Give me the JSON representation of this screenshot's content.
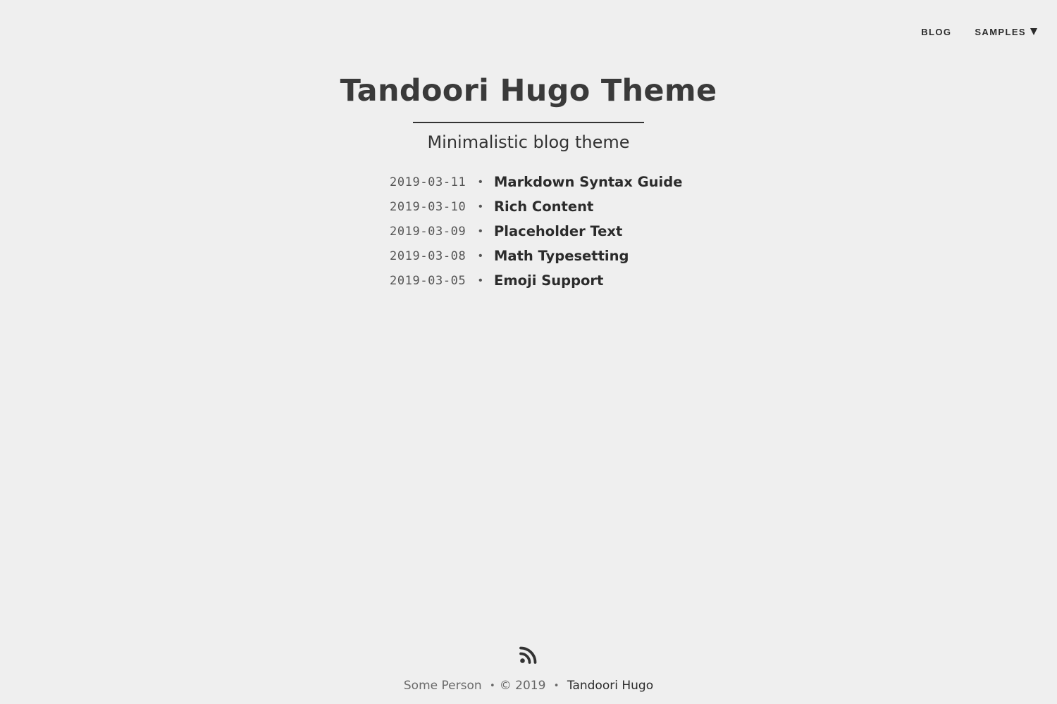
{
  "nav": {
    "items": [
      {
        "label": "BLOG"
      },
      {
        "label": "SAMPLES"
      }
    ]
  },
  "site": {
    "title": "Tandoori Hugo Theme",
    "subtitle": "Minimalistic blog theme"
  },
  "posts": [
    {
      "date": "2019-03-11",
      "title": "Markdown Syntax Guide"
    },
    {
      "date": "2019-03-10",
      "title": "Rich Content"
    },
    {
      "date": "2019-03-09",
      "title": "Placeholder Text"
    },
    {
      "date": "2019-03-08",
      "title": "Math Typesetting"
    },
    {
      "date": "2019-03-05",
      "title": "Emoji Support"
    }
  ],
  "separator": "•",
  "footer": {
    "author": "Some Person",
    "copyright": "© 2019",
    "theme_link": "Tandoori Hugo",
    "rss_icon": "rss-icon"
  },
  "colors": {
    "background": "#efefef",
    "text": "#333333"
  }
}
